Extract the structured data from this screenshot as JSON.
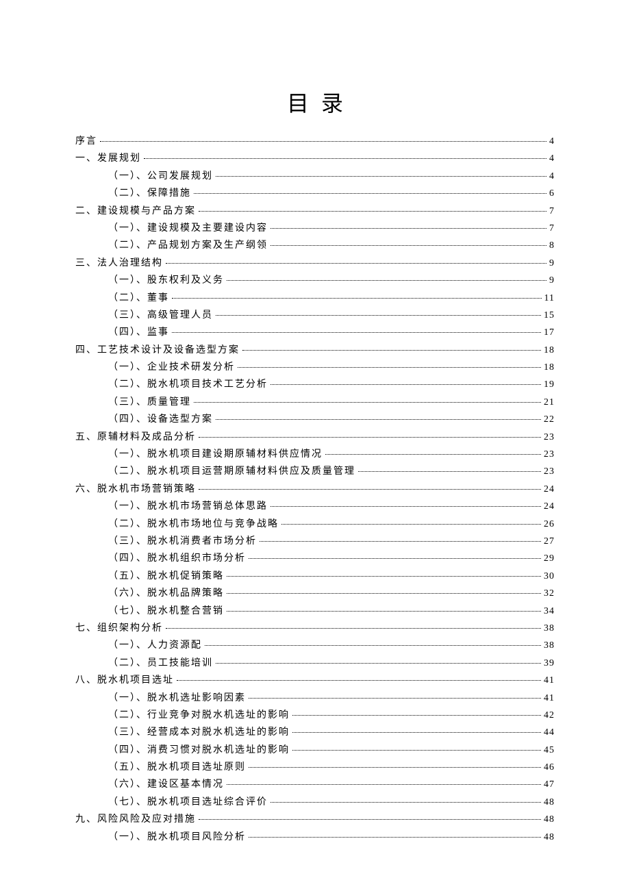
{
  "title": "目录",
  "toc": [
    {
      "level": 1,
      "label": "序言",
      "page": "4"
    },
    {
      "level": 1,
      "label": "一、发展规划",
      "page": "4"
    },
    {
      "level": 2,
      "label": "（一）、公司发展规划",
      "page": "4"
    },
    {
      "level": 2,
      "label": "（二）、保障措施",
      "page": "6"
    },
    {
      "level": 1,
      "label": "二、建设规模与产品方案",
      "page": "7"
    },
    {
      "level": 2,
      "label": "（一）、建设规模及主要建设内容",
      "page": "7"
    },
    {
      "level": 2,
      "label": "（二）、产品规划方案及生产纲领",
      "page": "8"
    },
    {
      "level": 1,
      "label": "三、法人治理结构",
      "page": "9"
    },
    {
      "level": 2,
      "label": "（一）、股东权利及义务",
      "page": "9"
    },
    {
      "level": 2,
      "label": "（二）、董事",
      "page": "11"
    },
    {
      "level": 2,
      "label": "（三）、高级管理人员",
      "page": "15"
    },
    {
      "level": 2,
      "label": "（四）、监事",
      "page": "17"
    },
    {
      "level": 1,
      "label": "四、工艺技术设计及设备选型方案",
      "page": "18"
    },
    {
      "level": 2,
      "label": "（一）、企业技术研发分析",
      "page": "18"
    },
    {
      "level": 2,
      "label": "（二）、脱水机项目技术工艺分析",
      "page": "19"
    },
    {
      "level": 2,
      "label": "（三）、质量管理",
      "page": "21"
    },
    {
      "level": 2,
      "label": "（四）、设备选型方案",
      "page": "22"
    },
    {
      "level": 1,
      "label": "五、原辅材料及成品分析",
      "page": "23"
    },
    {
      "level": 2,
      "label": "（一）、脱水机项目建设期原辅材料供应情况",
      "page": "23"
    },
    {
      "level": 2,
      "label": "（二）、脱水机项目运营期原辅材料供应及质量管理",
      "page": "23"
    },
    {
      "level": 1,
      "label": "六、脱水机市场营销策略",
      "page": "24"
    },
    {
      "level": 2,
      "label": "（一）、脱水机市场营销总体思路",
      "page": "24"
    },
    {
      "level": 2,
      "label": "（二）、脱水机市场地位与竞争战略",
      "page": "26"
    },
    {
      "level": 2,
      "label": "（三）、脱水机消费者市场分析",
      "page": "27"
    },
    {
      "level": 2,
      "label": "（四）、脱水机组织市场分析",
      "page": "29"
    },
    {
      "level": 2,
      "label": "（五）、脱水机促销策略",
      "page": "30"
    },
    {
      "level": 2,
      "label": "（六）、脱水机品牌策略",
      "page": "32"
    },
    {
      "level": 2,
      "label": "（七）、脱水机整合营销",
      "page": "34"
    },
    {
      "level": 1,
      "label": "七、组织架构分析",
      "page": "38"
    },
    {
      "level": 2,
      "label": "（一）、人力资源配",
      "page": "38"
    },
    {
      "level": 2,
      "label": "（二）、员工技能培训",
      "page": "39"
    },
    {
      "level": 1,
      "label": "八、脱水机项目选址",
      "page": "41"
    },
    {
      "level": 2,
      "label": "（一）、脱水机选址影响因素",
      "page": "41"
    },
    {
      "level": 2,
      "label": "（二）、行业竞争对脱水机选址的影响",
      "page": "42"
    },
    {
      "level": 2,
      "label": "（三）、经营成本对脱水机选址的影响",
      "page": "44"
    },
    {
      "level": 2,
      "label": "（四）、消费习惯对脱水机选址的影响",
      "page": "45"
    },
    {
      "level": 2,
      "label": "（五）、脱水机项目选址原则",
      "page": "46"
    },
    {
      "level": 2,
      "label": "（六）、建设区基本情况",
      "page": "47"
    },
    {
      "level": 2,
      "label": "（七）、脱水机项目选址综合评价",
      "page": "48"
    },
    {
      "level": 1,
      "label": "九、风险风险及应对措施",
      "page": "48"
    },
    {
      "level": 2,
      "label": "（一）、脱水机项目风险分析",
      "page": "48"
    }
  ]
}
